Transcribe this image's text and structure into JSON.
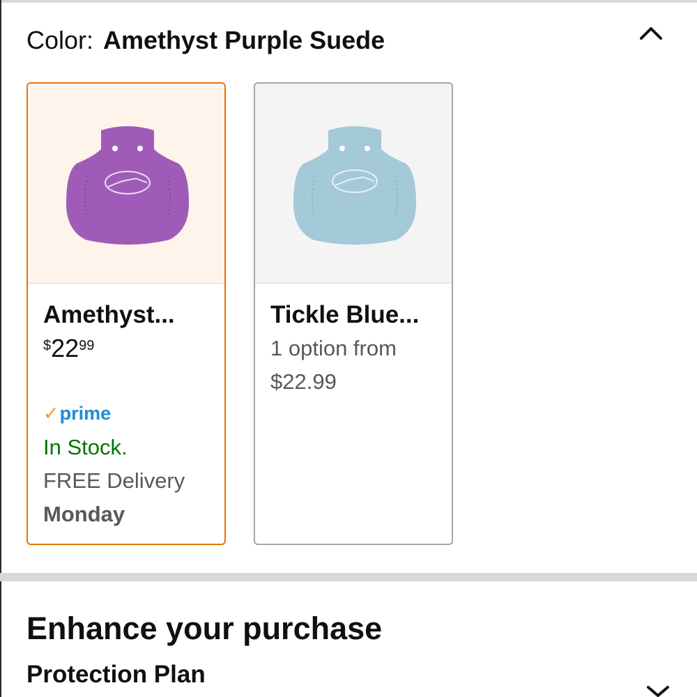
{
  "color_selector": {
    "label": "Color:",
    "selected_value": "Amethyst Purple Suede"
  },
  "swatches": [
    {
      "title": "Amethyst...",
      "price": {
        "symbol": "$",
        "whole": "22",
        "fraction": "99"
      },
      "prime_label": "prime",
      "stock": "In Stock.",
      "delivery": "FREE Delivery",
      "delivery_day": "Monday",
      "product_color": "#a05bb8",
      "selected": true
    },
    {
      "title": "Tickle Blue...",
      "option_line1": "1 option from",
      "option_line2": "$22.99",
      "product_color": "#a4c9d8",
      "selected": false
    }
  ],
  "enhance": {
    "title": "Enhance your purchase",
    "protection_label": "Protection Plan"
  },
  "colors": {
    "selected_border": "#e77600",
    "in_stock": "#007600",
    "prime_blue": "#1f8bd6",
    "prime_check": "#f39b1e"
  }
}
